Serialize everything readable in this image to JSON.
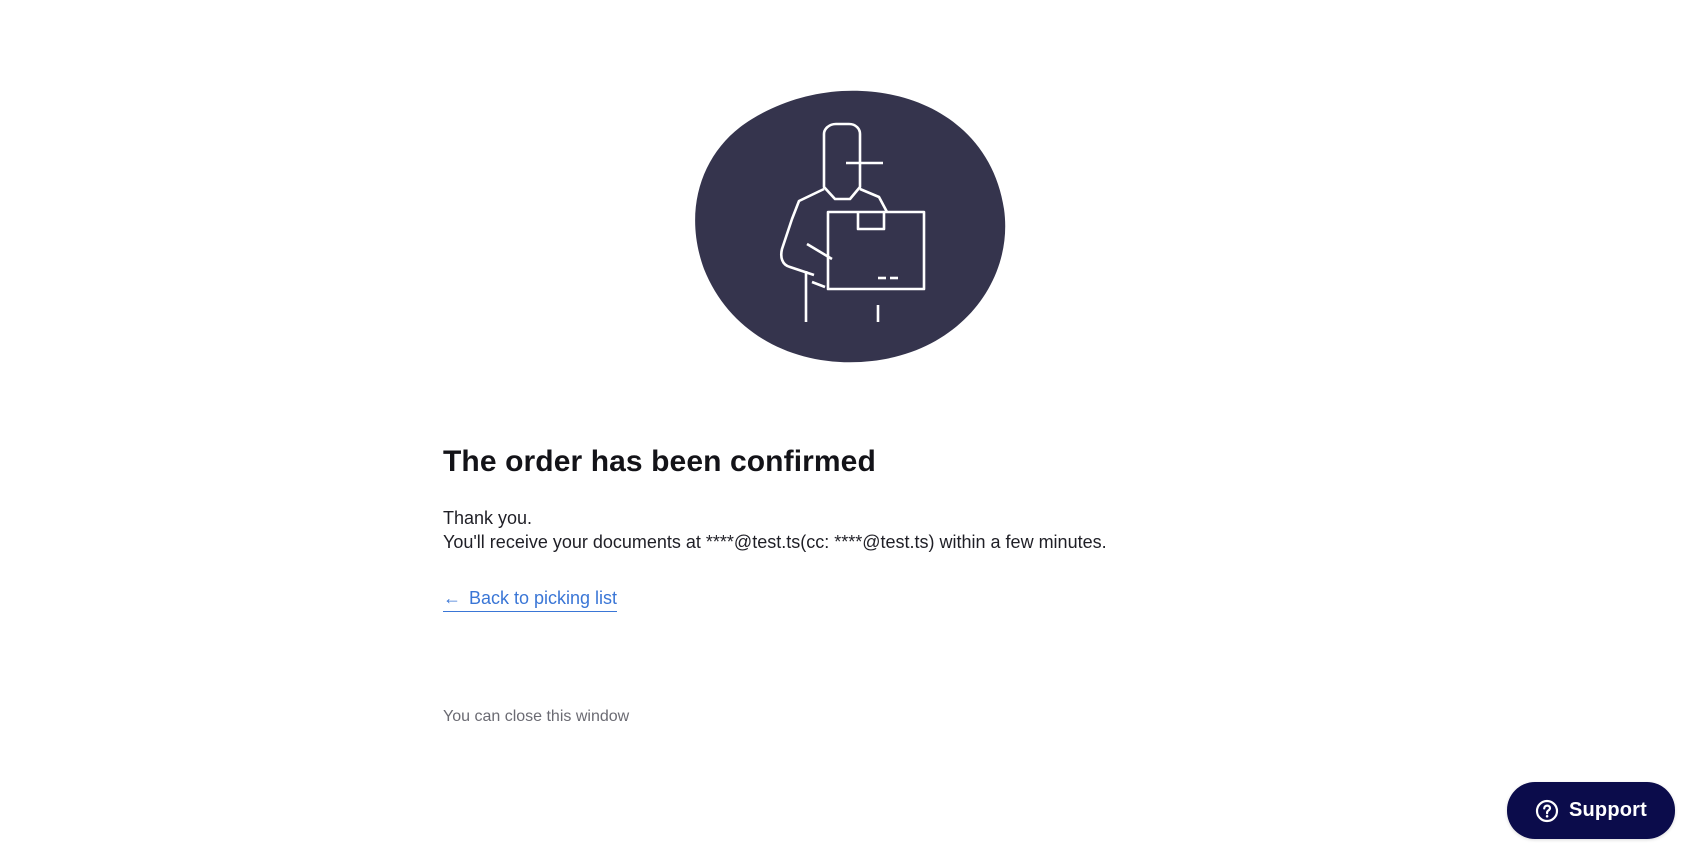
{
  "confirmation": {
    "title": "The order has been confirmed",
    "thanks": "Thank you.",
    "documents_notice": "You'll receive your documents at ****@test.ts(cc: ****@test.ts) within a few minutes.",
    "back_link_arrow": "←",
    "back_link_label": "Back to picking list",
    "close_note": "You can close this window"
  },
  "illustration": {
    "icon": "delivery-person-with-box-icon",
    "blob_color": "#35344d",
    "line_color": "#ffffff"
  },
  "support": {
    "label": "Support",
    "icon": "question-circle-icon",
    "background": "#0b0c4b"
  },
  "colors": {
    "link": "#3a76d6",
    "muted_text": "#6b6b73"
  }
}
